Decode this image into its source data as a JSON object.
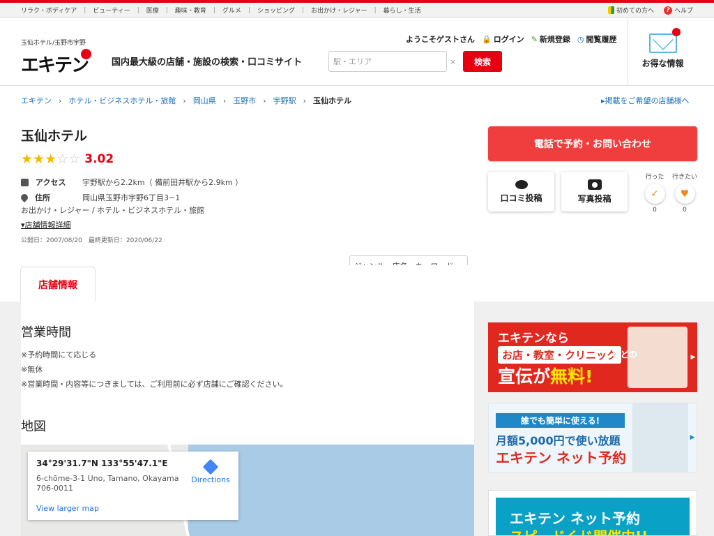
{
  "categories": [
    "リラク・ボディケア",
    "ビューティー",
    "医療",
    "趣味・教育",
    "グルメ",
    "ショッピング",
    "お出かけ・レジャー",
    "暮らし・生活"
  ],
  "help_links": {
    "first_time": "初めての方へ",
    "help": "ヘルプ"
  },
  "header": {
    "site_sub": "玉仙ホテル/玉野市宇野",
    "logo_text": "エキテン",
    "tagline": "国内最大級の店舗・施設の検索・口コミサイト",
    "welcome": "ようこそゲストさん",
    "login": "ログイン",
    "register": "新規登録",
    "history": "閲覧履歴",
    "search_station_placeholder": "駅・エリア",
    "search_keyword_placeholder": "ジャンル・店名・キーワード",
    "clear": "×",
    "search_button": "検索",
    "deals": "お得な情報"
  },
  "breadcrumb": [
    "エキテン",
    "ホテル・ビジネスホテル・旅館",
    "岡山県",
    "玉野市",
    "宇野駅",
    "玉仙ホテル"
  ],
  "advertise_link": "掲載をご希望の店舗様へ",
  "shop": {
    "name": "玉仙ホテル",
    "rating": 3.02,
    "rating_text": "3.02",
    "access_label": "アクセス",
    "access_value": "宇野駅から2.2km（ 備前田井駅から2.9km ）",
    "address_label": "住所",
    "address_value": "岡山県玉野市宇野6丁目3−1",
    "genres": "お出かけ・レジャー /  ホテル・ビジネスホテル・旅館",
    "detail_link": "店舗情報詳細",
    "dates": "公開日：2007/08/20　最終更新日：2020/06/22"
  },
  "actions": {
    "call": "電話で予約・お問い合わせ",
    "review": "口コミ投稿",
    "photo": "写真投稿",
    "went_label": "行った",
    "went_count": "0",
    "want_label": "行きたい",
    "want_count": "0"
  },
  "tab": {
    "label": "店舗情報"
  },
  "hours": {
    "title": "営業時間",
    "lines": [
      "※予約時間にて応じる",
      "※無休",
      "※営業時間・内容等につきましては、ご利用前に必ず店舗にご確認ください。"
    ]
  },
  "map": {
    "title": "地図",
    "coords": "34°29'31.7\"N 133°55'47.1\"E",
    "address_line1": "6-chōme-3-1 Uno, Tamano, Okayama",
    "address_line2": "706-0011",
    "directions": "Directions",
    "larger": "View larger map"
  },
  "banners": {
    "b1_l1": "エキテンなら",
    "b1_l2": "お店・教室・クリニック",
    "b1_l2b": "などの",
    "b1_l3a": "宣伝が",
    "b1_l3b": "無料!",
    "b2_l1": "誰でも簡単に使える!",
    "b2_l2": "月額5,000円で使い放題",
    "b2_l3": "エキテン ネット予約",
    "b3_l1": "エキテン ネット予約",
    "b3_l2": "スピードくじ開催中!!"
  }
}
